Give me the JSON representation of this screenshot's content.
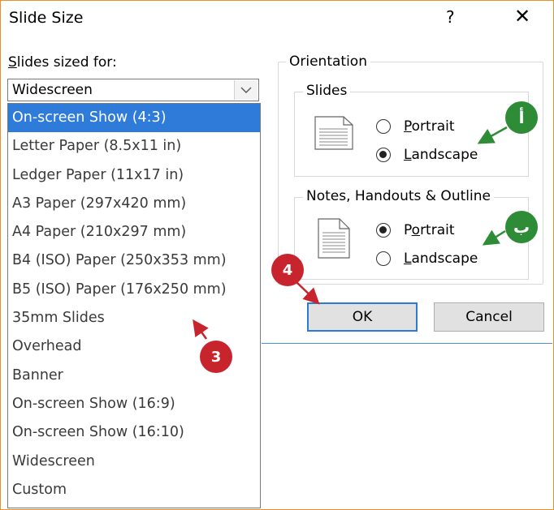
{
  "window": {
    "title": "Slide Size",
    "help_glyph": "?",
    "close_glyph": "✕"
  },
  "sized_for": {
    "label_first": "S",
    "label_rest": "lides sized for:",
    "selected": "Widescreen",
    "options": [
      "On-screen Show (4:3)",
      "Letter Paper (8.5x11 in)",
      "Ledger Paper (11x17 in)",
      "A3 Paper (297x420 mm)",
      "A4 Paper (210x297 mm)",
      "B4 (ISO) Paper (250x353 mm)",
      "B5 (ISO) Paper (176x250 mm)",
      "35mm Slides",
      "Overhead",
      "Banner",
      "On-screen Show (16:9)",
      "On-screen Show (16:10)",
      "Widescreen",
      "Custom"
    ],
    "highlighted_index": 0
  },
  "orientation": {
    "label": "Orientation",
    "slides": {
      "label": "Slides",
      "portrait_first": "P",
      "portrait_rest": "ortrait",
      "landscape_first": "L",
      "landscape_rest": "andscape",
      "selected": "landscape"
    },
    "notes": {
      "label": "Notes, Handouts & Outline",
      "portrait_pre": "P",
      "portrait_u": "o",
      "portrait_rest": "rtrait",
      "landscape_first": "L",
      "landscape_rest": "andscape",
      "selected": "portrait"
    }
  },
  "buttons": {
    "ok": "OK",
    "cancel": "Cancel"
  },
  "annotations": {
    "marker_3": "3",
    "marker_4": "4",
    "marker_alef": "أ",
    "marker_ba": "ب",
    "red": "#c8242d",
    "green": "#2e8b36"
  },
  "colors": {
    "selection": "#2f7bd9",
    "default_button_border": "#2a7bd4",
    "frame": "#e8912b"
  }
}
